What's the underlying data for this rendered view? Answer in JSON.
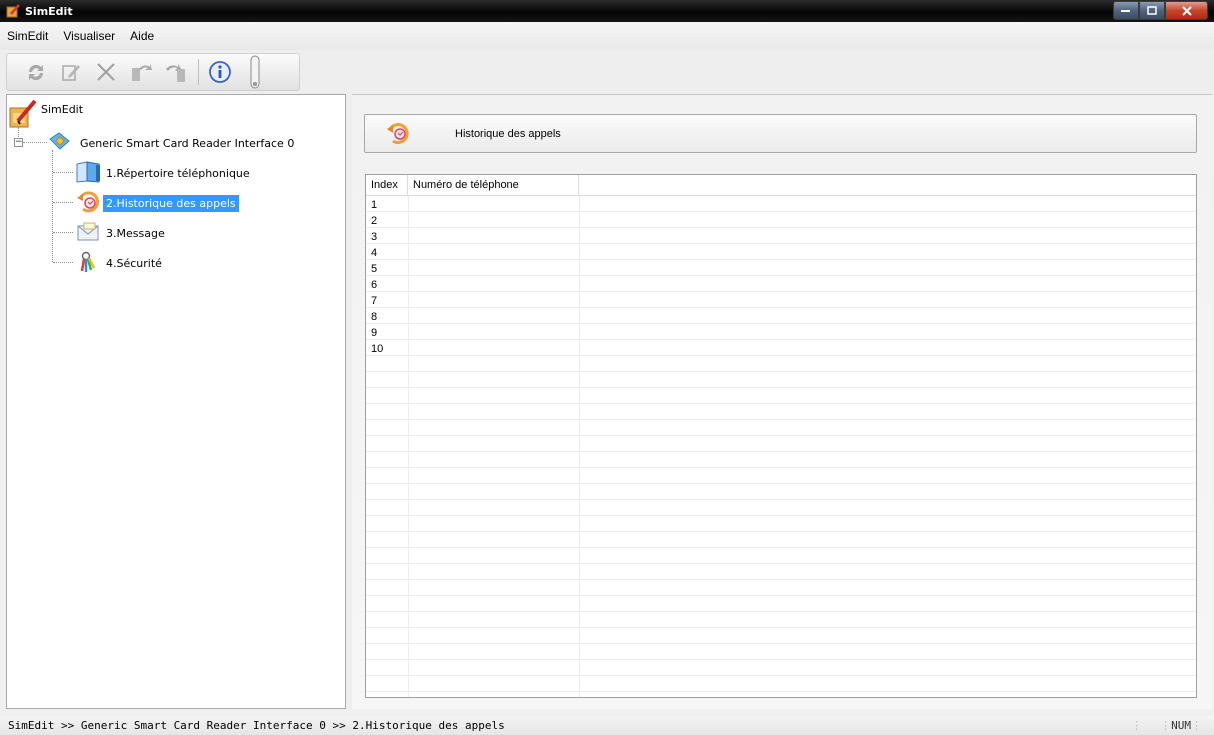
{
  "window": {
    "title": "SimEdit"
  },
  "menu": {
    "items": [
      "SimEdit",
      "Visualiser",
      "Aide"
    ]
  },
  "toolbar": {
    "icons": [
      "refresh-icon",
      "edit-icon",
      "delete-icon",
      "undo-icon",
      "redo-icon",
      "info-icon"
    ]
  },
  "tree": {
    "root": "SimEdit",
    "reader": "Generic Smart Card Reader Interface 0",
    "items": [
      "1.Répertoire téléphonique",
      "2.Historique des appels",
      "3.Message",
      "4.Sécurité"
    ],
    "selected_index": 1
  },
  "content": {
    "header_title": "Historique des appels",
    "columns": [
      "Index",
      "Numéro de téléphone"
    ],
    "rows": [
      "1",
      "2",
      "3",
      "4",
      "5",
      "6",
      "7",
      "8",
      "9",
      "10"
    ]
  },
  "status": {
    "path": "SimEdit >> Generic Smart Card Reader Interface 0 >> 2.Historique des appels",
    "indicator": "NUM"
  },
  "colors": {
    "selection": "#3399ff",
    "titlebar": "#0a0a0a"
  }
}
